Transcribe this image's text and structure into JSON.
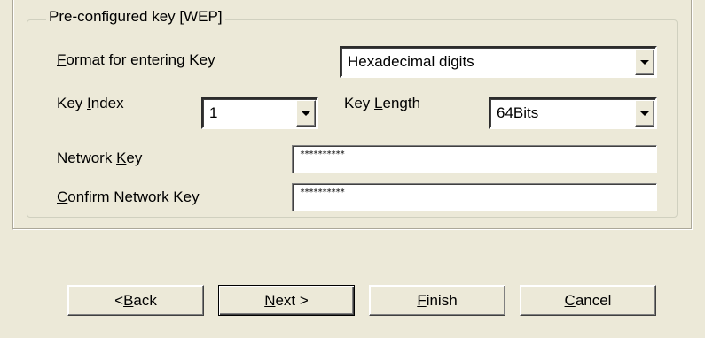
{
  "group": {
    "title": "Pre-configured key [WEP]"
  },
  "format": {
    "label_pre": "",
    "label_mnemonic": "F",
    "label_post": "ormat for entering Key",
    "value": "Hexadecimal digits"
  },
  "key_index": {
    "label_pre": "Key ",
    "label_mnemonic": "I",
    "label_post": "ndex",
    "value": "1"
  },
  "key_length": {
    "label_pre": "Key ",
    "label_mnemonic": "L",
    "label_post": "ength",
    "value": "64Bits"
  },
  "network_key": {
    "label_pre": "Network ",
    "label_mnemonic": "K",
    "label_post": "ey",
    "value": "**********"
  },
  "confirm_key": {
    "label_pre": "",
    "label_mnemonic": "C",
    "label_post": "onfirm Network Key",
    "value": "**********"
  },
  "buttons": {
    "back": {
      "pre": "< ",
      "mnemonic": "B",
      "post": "ack"
    },
    "next": {
      "pre": "",
      "mnemonic": "N",
      "post": "ext >"
    },
    "finish": {
      "pre": "",
      "mnemonic": "F",
      "post": "inish"
    },
    "cancel": {
      "pre": "",
      "mnemonic": "C",
      "post": "ancel"
    }
  }
}
